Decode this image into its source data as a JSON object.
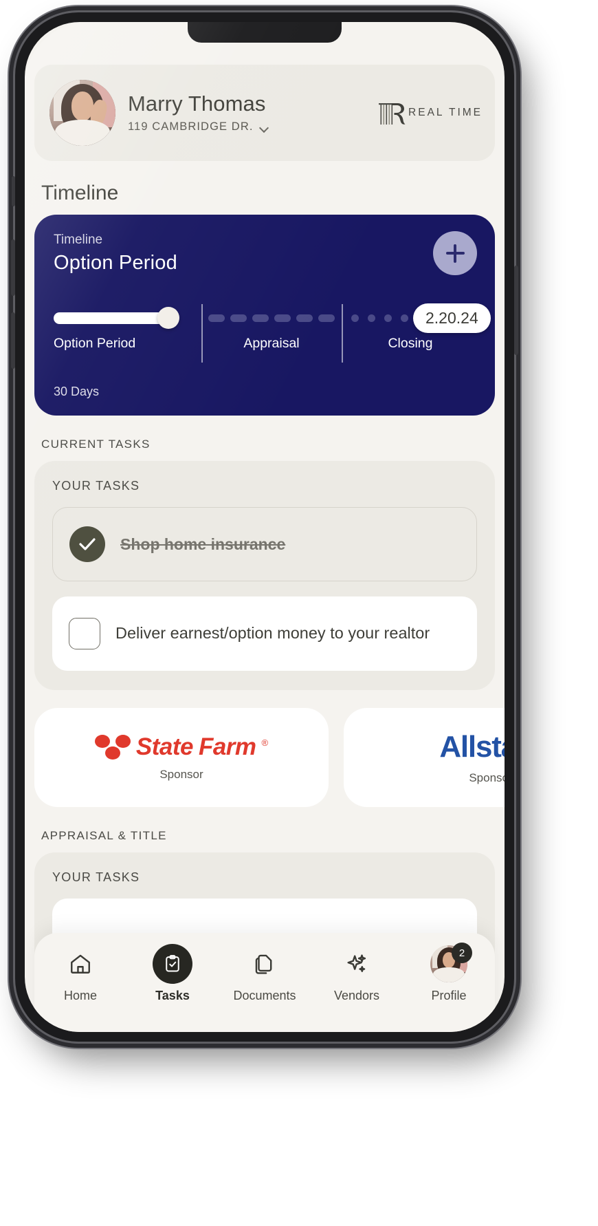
{
  "header": {
    "user_name": "Marry Thomas",
    "address": "119 CAMBRIDGE DR.",
    "address_chevron": "chevron-down-icon",
    "brand_word": "REAL TIME",
    "brand_mark": "R-monogram-icon"
  },
  "page_title": "Timeline",
  "timeline": {
    "kicker": "Timeline",
    "title": "Option Period",
    "add_label": "+",
    "days": "30 Days",
    "stages": [
      {
        "name": "Option Period",
        "state": "complete"
      },
      {
        "name": "Appraisal",
        "state": "pending"
      },
      {
        "name": "Closing",
        "state": "upcoming",
        "date": "2.20.24"
      }
    ]
  },
  "sections": [
    {
      "label": "CURRENT TASKS",
      "group_label": "YOUR TASKS",
      "tasks": [
        {
          "text": "Shop home insurance",
          "done": true
        },
        {
          "text": "Deliver earnest/option money to your realtor",
          "done": false
        }
      ]
    },
    {
      "label": "APPRAISAL & TITLE",
      "group_label": "YOUR TASKS",
      "tasks": []
    }
  ],
  "sponsors": [
    {
      "brand": "StateFarm",
      "name_part1": "State",
      "name_part2": "Farm",
      "registered": "®",
      "caption": "Sponsor",
      "color": "#e0392c"
    },
    {
      "brand": "Allstate",
      "name": "Allstate",
      "caption": "Sponsor",
      "color": "#2352a5"
    }
  ],
  "bottom_nav": {
    "items": [
      {
        "label": "Home",
        "icon": "home-icon",
        "active": false
      },
      {
        "label": "Tasks",
        "icon": "clipboard-check-icon",
        "active": true
      },
      {
        "label": "Documents",
        "icon": "documents-icon",
        "active": false
      },
      {
        "label": "Vendors",
        "icon": "sparkles-icon",
        "active": false
      },
      {
        "label": "Profile",
        "icon": "avatar-icon",
        "active": false,
        "badge": "2"
      }
    ]
  },
  "colors": {
    "screen_bg": "#f5f3ef",
    "card_bg": "#eceae4",
    "timeline_navy": "#181762",
    "accent_lavender": "#a9a9cd",
    "check_olive": "#4c4d3d"
  }
}
